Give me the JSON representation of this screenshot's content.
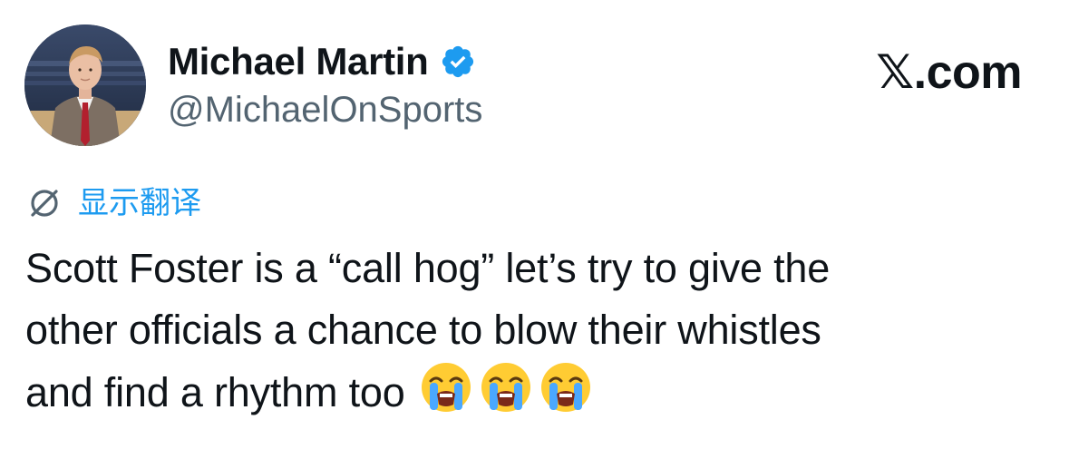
{
  "author": {
    "display_name": "Michael Martin",
    "handle": "@MichaelOnSports",
    "verified": true,
    "avatar": "profile-photo-man-in-suit"
  },
  "brand": {
    "label": "𝕏.com"
  },
  "translate": {
    "icon": "globe-slash-icon",
    "label": "显示翻译"
  },
  "tweet": {
    "lines": [
      "Scott Foster is a “call hog” let’s try to give the",
      "other officials a chance to blow their whistles",
      "and find a rhythm too"
    ],
    "emojis": [
      "loudly-crying-face",
      "loudly-crying-face",
      "loudly-crying-face"
    ]
  },
  "colors": {
    "text": "#0f1419",
    "secondary": "#536471",
    "accent": "#1d9bf0"
  }
}
